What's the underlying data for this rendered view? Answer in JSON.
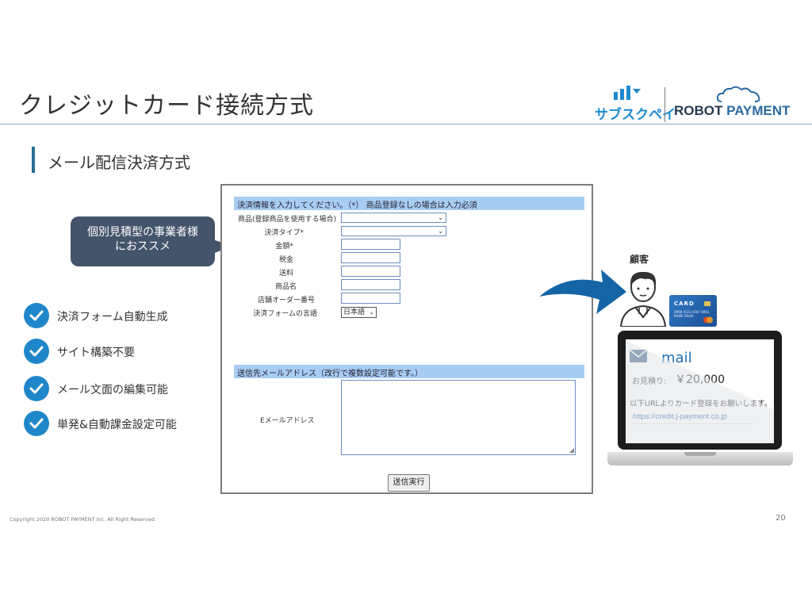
{
  "title": "クレジットカード接続方式",
  "logos": {
    "subscpay": "サブスクペイ",
    "robot": "ROBOT",
    "payment": "PAYMENT"
  },
  "subtitle": "メール配信決済方式",
  "callout": {
    "line1": "個別見積型の事業者様",
    "line2": "におススメ"
  },
  "features": [
    "決済フォーム自動生成",
    "サイト構築不要",
    "メール文面の編集可能",
    "単発&自動課金設定可能"
  ],
  "form": {
    "header1": "決済情報を入力してください。（*） 商品登録なしの場合は入力必須",
    "fields": [
      "商品(登録商品を使用する場合)",
      "決済タイプ*",
      "金額*",
      "税金",
      "送料",
      "商品名",
      "店舗オーダー番号",
      "決済フォームの言語"
    ],
    "language_value": "日本語",
    "header2": "送信先メールアドレス（改行で複数設定可能です。）",
    "email_label": "Eメールアドレス",
    "submit_label": "送信実行"
  },
  "customer_label": "顧客",
  "card": {
    "label": "CARD",
    "number": "4998 0123 4567 8901",
    "name_line": "NAME   00/00"
  },
  "mail_screen": {
    "title": "mail",
    "estimate_label": "お見積り:",
    "estimate_value": "￥20,000",
    "message": "以下URLよりカード登録をお願いします。",
    "url": "https://credit.j-payment.co.jp"
  },
  "footer": {
    "copyright": "Copyright 2020 ROBOT PAYMENT Inc. All Right Reserved.",
    "page": "20"
  },
  "colors": {
    "accent": "#1f87c9",
    "callout": "#44546a",
    "form_header": "#a8cdf3",
    "arrow": "#1565a6"
  }
}
